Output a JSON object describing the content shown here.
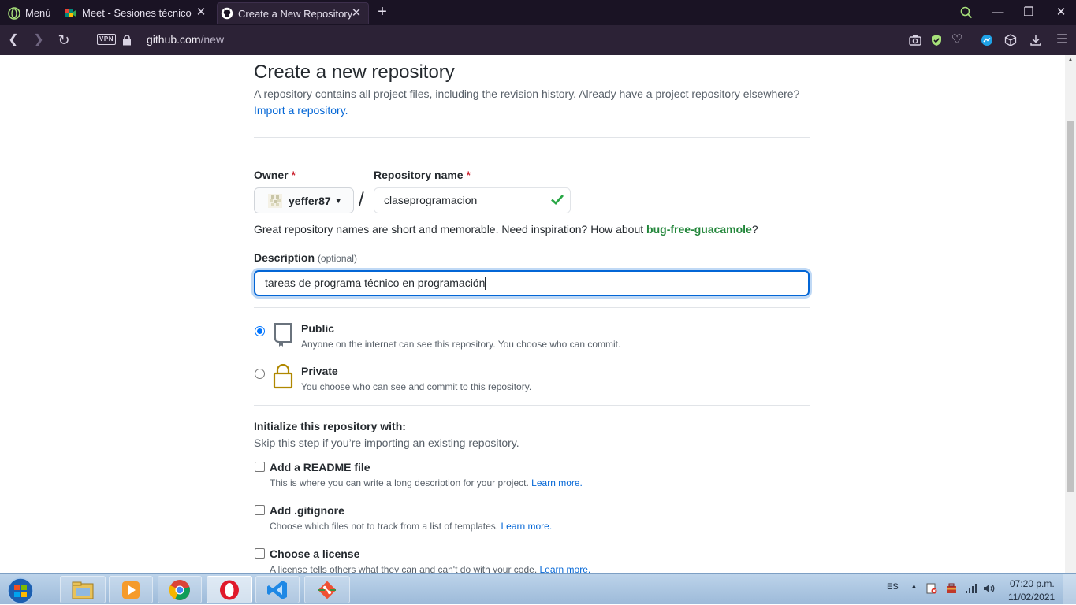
{
  "browser": {
    "tabs": [
      {
        "label": "Menú"
      },
      {
        "label": "Meet - Sesiones técnico pr"
      },
      {
        "label": "Create a New Repository"
      }
    ],
    "url_host": "github.com",
    "url_path": "/new",
    "vpn_label": "VPN"
  },
  "page": {
    "title": "Create a new repository",
    "subtitle": "A repository contains all project files, including the revision history. Already have a project repository elsewhere?",
    "import_link": "Import a repository.",
    "owner_label": "Owner",
    "required_mark": "*",
    "repo_name_label": "Repository name",
    "owner_value": "yeffer87",
    "slash": "/",
    "repo_name_value": "claseprogramacion",
    "hint_prefix": "Great repository names are short and memorable. Need inspiration? How about ",
    "hint_suggestion": "bug-free-guacamole",
    "hint_suffix": "?",
    "description_label": "Description",
    "description_optional": "(optional)",
    "description_value": "tareas de programa técnico en programación",
    "visibility": {
      "selected": "public",
      "public_title": "Public",
      "public_desc": "Anyone on the internet can see this repository. You choose who can commit.",
      "private_title": "Private",
      "private_desc": "You choose who can see and commit to this repository."
    },
    "init_title": "Initialize this repository with:",
    "init_desc": "Skip this step if you’re importing an existing repository.",
    "options": [
      {
        "title": "Add a README file",
        "desc": "This is where you can write a long description for your project.",
        "link": "Learn more."
      },
      {
        "title": "Add .gitignore",
        "desc": "Choose which files not to track from a list of templates.",
        "link": "Learn more."
      },
      {
        "title": "Choose a license",
        "desc": "A license tells others what they can and can't do with your code.",
        "link": "Learn more."
      }
    ]
  },
  "taskbar": {
    "language": "ES",
    "time": "07:20 p.m.",
    "date": "11/02/2021"
  },
  "colors": {
    "link": "#0366d6",
    "success": "#28a745",
    "suggestion": "#22863a",
    "focus_border": "#0366d6",
    "browser_bg": "#1a1324"
  },
  "icons": [
    "opera-icon",
    "meet-icon",
    "github-icon",
    "search-icon",
    "camera-icon",
    "shield-icon",
    "heart-icon",
    "box-icon",
    "download-icon",
    "menu-icon",
    "repo-icon",
    "lock-icon",
    "checkmark-icon",
    "windows-start-icon",
    "explorer-icon",
    "media-player-icon",
    "chrome-icon",
    "vscode-icon",
    "git-icon",
    "volume-icon",
    "network-icon"
  ]
}
